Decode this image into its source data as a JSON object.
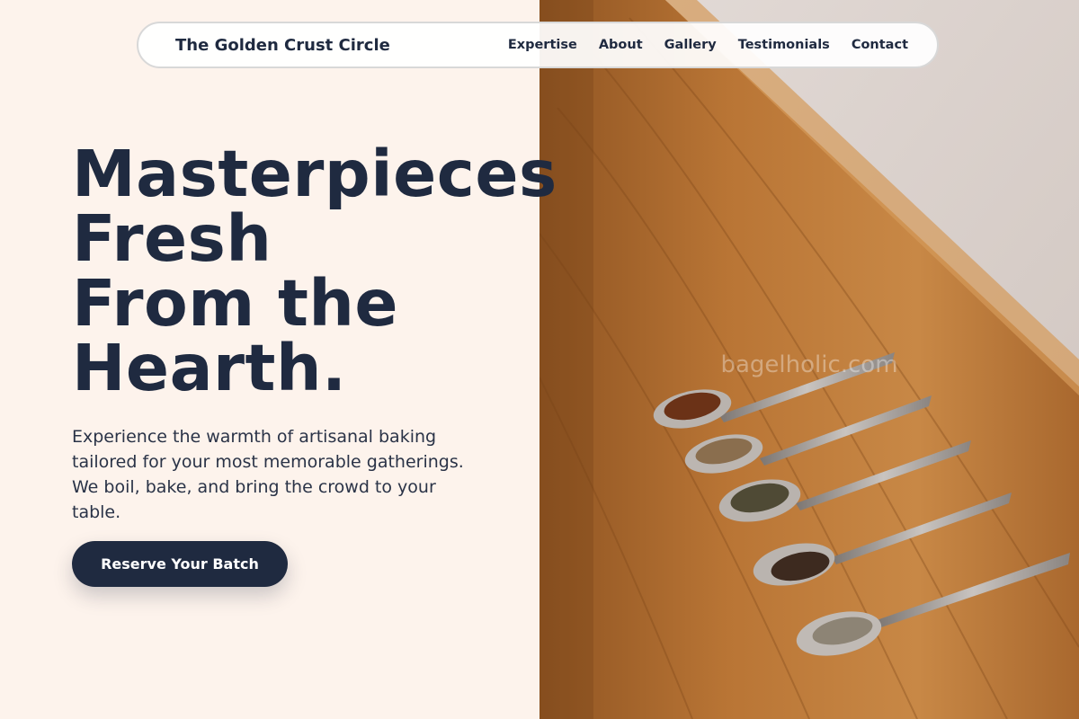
{
  "header": {
    "brand": "The Golden Crust Circle",
    "nav": [
      "Expertise",
      "About",
      "Gallery",
      "Testimonials",
      "Contact"
    ]
  },
  "hero": {
    "title_lines": [
      "Masterpieces",
      "Fresh",
      "From the",
      "Hearth."
    ],
    "description": "Experience the warmth of artisanal baking tailored for your most memorable gatherings. We boil, bake, and bring the crowd to your table.",
    "cta_label": "Reserve Your Batch",
    "image_watermark": "bagelholic.com"
  },
  "colors": {
    "background": "#fdf3ec",
    "primary": "#1f2a40",
    "wood": "#b87437"
  }
}
